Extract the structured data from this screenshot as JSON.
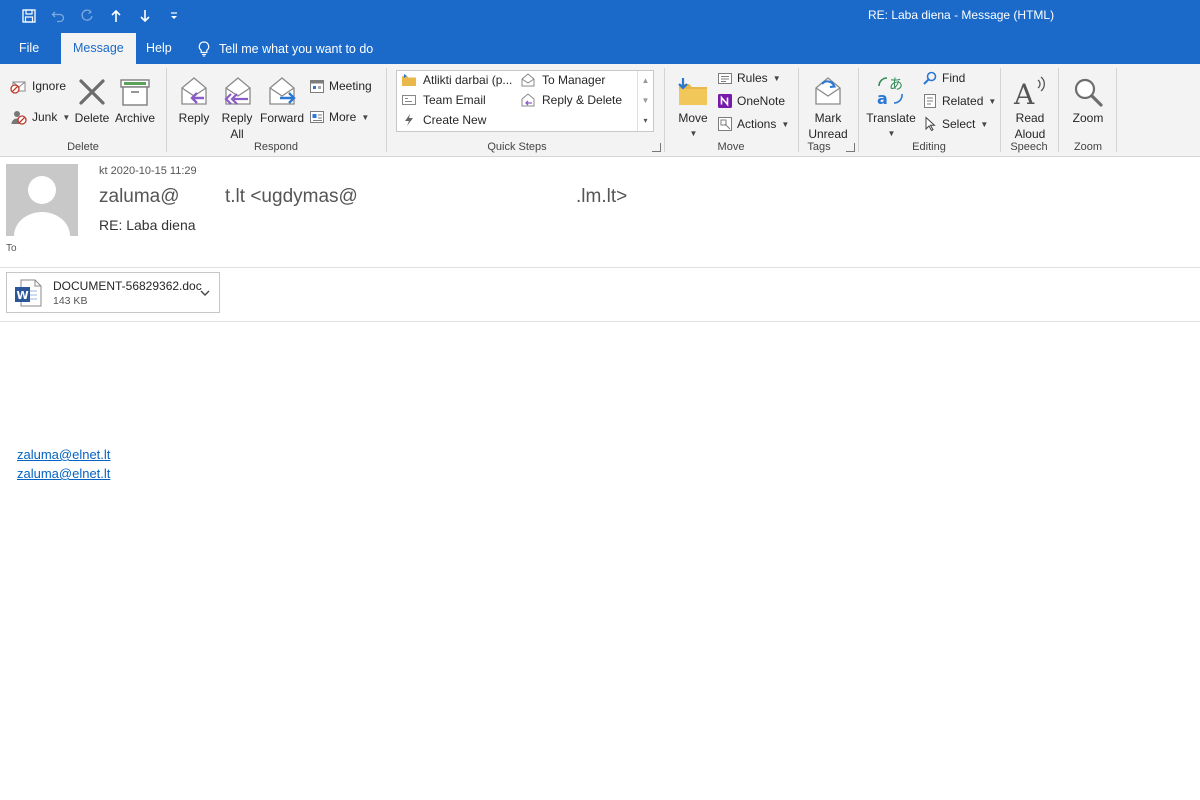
{
  "window": {
    "title": "RE: Laba diena  -  Message (HTML)"
  },
  "tabs": [
    {
      "label": "File"
    },
    {
      "label": "Message"
    },
    {
      "label": "Help"
    }
  ],
  "tellme": {
    "placeholder": "Tell me what you want to do"
  },
  "ribbon": {
    "delete_group": {
      "label": "Delete",
      "ignore": "Ignore",
      "junk": "Junk",
      "delete": "Delete",
      "archive": "Archive"
    },
    "respond_group": {
      "label": "Respond",
      "reply": "Reply",
      "reply_all_1": "Reply",
      "reply_all_2": "All",
      "forward": "Forward",
      "meeting": "Meeting",
      "more": "More"
    },
    "quicksteps_group": {
      "label": "Quick Steps",
      "items": [
        "Atlikti darbai (p...",
        "To Manager",
        "Team Email",
        "Reply & Delete",
        "Create New"
      ]
    },
    "move_group": {
      "label": "Move",
      "move": "Move",
      "rules": "Rules",
      "onenote": "OneNote",
      "actions": "Actions"
    },
    "tags_group": {
      "label": "Tags",
      "mark_unread_1": "Mark",
      "mark_unread_2": "Unread"
    },
    "editing_group": {
      "label": "Editing",
      "translate": "Translate",
      "find": "Find",
      "related": "Related",
      "select": "Select"
    },
    "speech_group": {
      "label": "Speech",
      "read_aloud_1": "Read",
      "read_aloud_2": "Aloud"
    },
    "zoom_group": {
      "label": "Zoom",
      "zoom": "Zoom"
    }
  },
  "message": {
    "sent": "kt 2020-10-15 11:29",
    "from_part1": "zaluma@",
    "from_part2": "t.lt <ugdymas@",
    "from_part3": ".lm.lt>",
    "subject": "RE: Laba diena",
    "to_label": "To"
  },
  "attachment": {
    "name": "DOCUMENT-56829362.doc",
    "size": "143 KB"
  },
  "body": {
    "links": [
      "zaluma@elnet.lt",
      "zaluma@elnet.lt"
    ]
  },
  "colors": {
    "accent": "#1b6ac9",
    "link": "#0563c1"
  }
}
